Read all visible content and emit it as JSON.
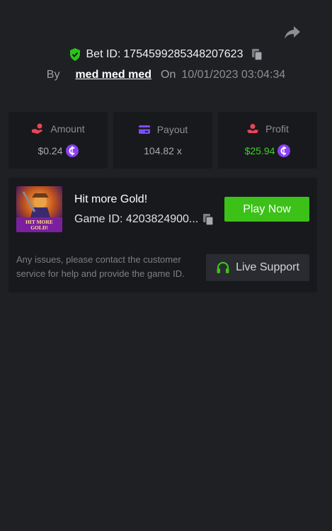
{
  "bet": {
    "id_label": "Bet ID:",
    "id_value": "1754599285348207623",
    "by_label": "By",
    "username": "med med med",
    "on_label": "On",
    "datetime": "10/01/2023 03:04:34"
  },
  "stats": {
    "amount": {
      "label": "Amount",
      "value": "$0.24"
    },
    "payout": {
      "label": "Payout",
      "value": "104.82 x"
    },
    "profit": {
      "label": "Profit",
      "value": "$25.94"
    }
  },
  "game": {
    "title": "Hit more Gold!",
    "id_label": "Game ID:",
    "id_value": "4203824900...",
    "thumb_text": "HIT MORE GOLD!",
    "play_label": "Play Now"
  },
  "support": {
    "text": "Any issues, please contact the customer service for help and provide the game ID.",
    "button_label": "Live Support"
  },
  "icons": {
    "share": "share-arrow-icon",
    "verified": "shield-check-icon",
    "copy": "copy-icon",
    "amount": "hand-coin-icon",
    "payout": "card-icon",
    "profit": "profit-hand-icon",
    "coin": "currency-coin-icon",
    "support": "headset-icon"
  },
  "colors": {
    "background": "#1f2024",
    "card": "#18191c",
    "accent_green": "#3bc117",
    "profit_green": "#3fcf2b",
    "coin_purple": "#8a3ff2",
    "shield_green": "#29c41a",
    "payout_purple": "#7a4ef5",
    "icon_red": "#e8455a"
  }
}
